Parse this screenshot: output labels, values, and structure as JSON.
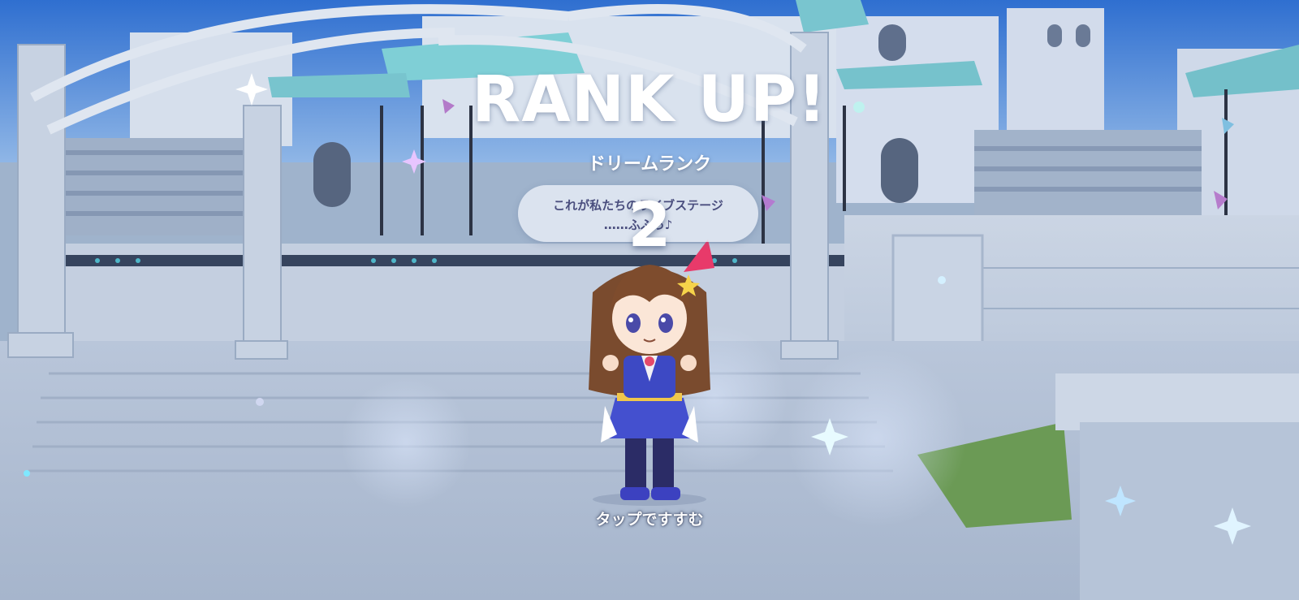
{
  "rank_up": {
    "title": "RANK UP!",
    "label": "ドリームランク",
    "rank_value": "2",
    "speech_line1": "これが私たちのライブステージ",
    "speech_line2": "……ふふっ♪",
    "tap_prompt": "タップですすむ"
  },
  "colors": {
    "sky": "#3f7fd6",
    "stone": "#c8d4e4",
    "roof_teal": "#6fc6d0",
    "hair_ribbon": "#e83a6a",
    "outfit": "#3f4fc8"
  },
  "icons": [
    "sparkle-icon",
    "speech-bubble",
    "character-sprite"
  ]
}
